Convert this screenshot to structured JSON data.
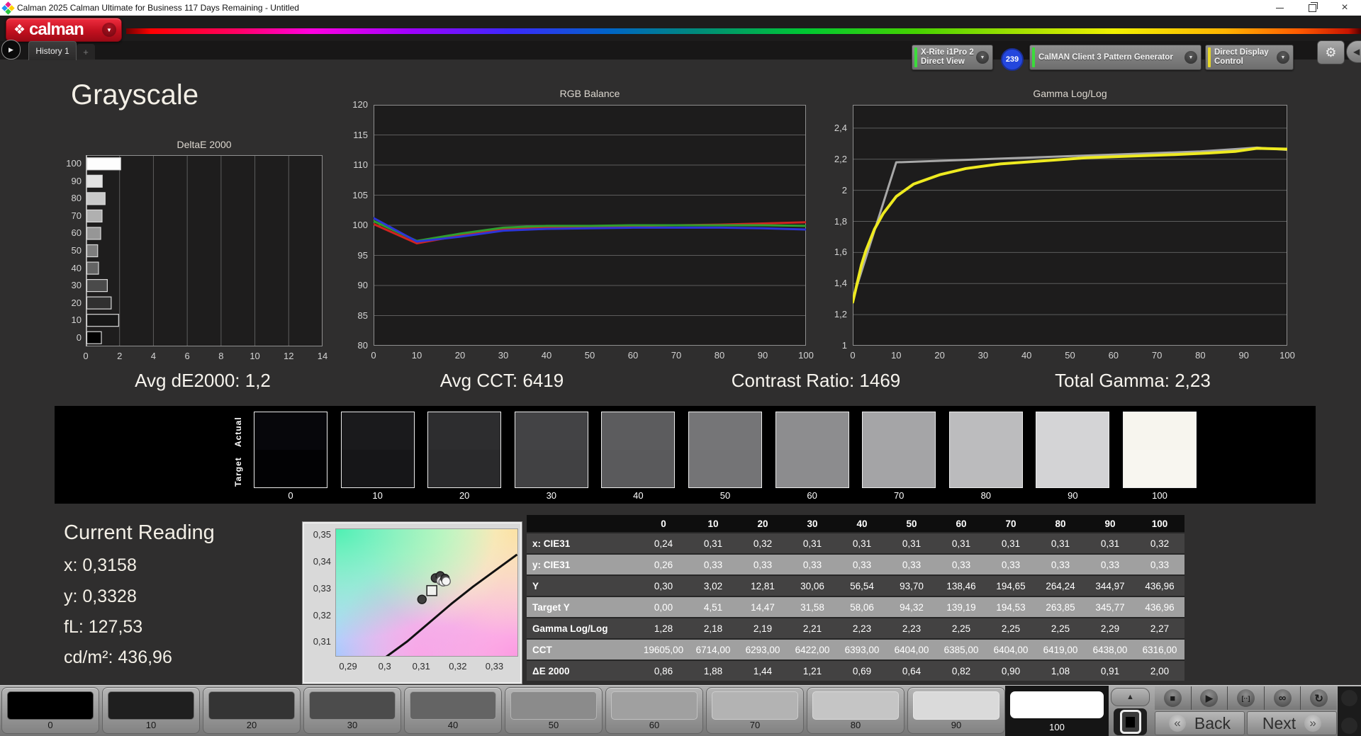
{
  "window": {
    "title": "Calman 2025 Calman Ultimate for Business 117 Days Remaining  - Untitled"
  },
  "icons": {
    "logo_diamond": "❖",
    "dropdown_arrow": "▼",
    "history_play": "▶",
    "gear": "⚙",
    "collapse": "◀",
    "scroll_up": "▲",
    "close": "×"
  },
  "header": {
    "logo_text": "calman",
    "badge": "239",
    "devices": [
      {
        "name": "meter-dropdown",
        "line1": "X-Rite i1Pro 2",
        "line2": "Direct View",
        "accent": "#3bdc3b"
      },
      {
        "name": "pattern-generator-dropdown",
        "line1": "CalMAN Client 3 Pattern Generator",
        "line2": "",
        "accent": "#3bdc3b"
      },
      {
        "name": "display-control-dropdown",
        "line1": "Direct Display Control",
        "line2": "",
        "accent": "#e6d62a"
      }
    ]
  },
  "tabs": {
    "history": "History 1",
    "add": "+"
  },
  "page": {
    "title": "Grayscale"
  },
  "stats": [
    {
      "text": "Avg dE2000: 1,2"
    },
    {
      "text": "Avg CCT: 6419"
    },
    {
      "text": "Contrast Ratio: 1469"
    },
    {
      "text": "Total Gamma: 2,23"
    }
  ],
  "chart_data": {
    "deltae": {
      "type": "bar",
      "title": "DeltaE 2000",
      "orientation": "horizontal",
      "categories": [
        "100",
        "90",
        "80",
        "70",
        "60",
        "50",
        "40",
        "30",
        "20",
        "10",
        "0"
      ],
      "values": [
        2.0,
        0.91,
        1.08,
        0.9,
        0.82,
        0.64,
        0.69,
        1.21,
        1.44,
        1.88,
        0.86
      ],
      "xlim": [
        0,
        14
      ],
      "xticks": [
        0,
        2,
        4,
        6,
        8,
        10,
        12,
        14
      ],
      "bar_colors": [
        "#fdfdfd",
        "#e2e2e2",
        "#c9c9c9",
        "#b0b0b0",
        "#969696",
        "#7d7d7d",
        "#636363",
        "#4a4a4a",
        "#303030",
        "#171717",
        "#020202"
      ]
    },
    "rgb_balance": {
      "type": "line",
      "title": "RGB Balance",
      "x": [
        0,
        10,
        20,
        30,
        40,
        50,
        60,
        70,
        80,
        90,
        100
      ],
      "xticks": [
        0,
        10,
        20,
        30,
        40,
        50,
        60,
        70,
        80,
        90,
        100
      ],
      "ylim": [
        80,
        120
      ],
      "yticks": [
        {
          "v": 120,
          "label": "120"
        },
        {
          "v": 115,
          "label": "115"
        },
        {
          "v": 110,
          "label": "110"
        },
        {
          "v": 105,
          "label": "105"
        },
        {
          "v": 100,
          "label": "100"
        },
        {
          "v": 95,
          "label": "95"
        },
        {
          "v": 90,
          "label": "90"
        },
        {
          "v": 85,
          "label": "85"
        },
        {
          "v": 80,
          "label": "80"
        }
      ],
      "series": [
        {
          "name": "Red",
          "color": "#d02420",
          "width": 3,
          "values": [
            100.2,
            97.0,
            98.3,
            99.3,
            99.7,
            99.7,
            99.9,
            100.0,
            100.1,
            100.3,
            100.5
          ]
        },
        {
          "name": "Green",
          "color": "#2f9e2f",
          "width": 3,
          "values": [
            100.7,
            97.4,
            98.6,
            99.6,
            99.9,
            99.9,
            100.0,
            100.0,
            100.0,
            100.0,
            99.9
          ]
        },
        {
          "name": "Blue",
          "color": "#2c35d8",
          "width": 3,
          "values": [
            101.2,
            97.3,
            98.1,
            99.1,
            99.4,
            99.5,
            99.6,
            99.6,
            99.6,
            99.5,
            99.3
          ]
        }
      ]
    },
    "gamma": {
      "type": "line",
      "title": "Gamma Log/Log",
      "xlim": [
        0,
        100
      ],
      "xticks": [
        0,
        10,
        20,
        30,
        40,
        50,
        60,
        70,
        80,
        90,
        100
      ],
      "ylim": [
        1,
        2.55
      ],
      "yticks": [
        {
          "v": 2.4,
          "label": "2,4"
        },
        {
          "v": 2.2,
          "label": "2,2"
        },
        {
          "v": 2.0,
          "label": "2"
        },
        {
          "v": 1.8,
          "label": "1,8"
        },
        {
          "v": 1.6,
          "label": "1,6"
        },
        {
          "v": 1.4,
          "label": "1,4"
        },
        {
          "v": 1.2,
          "label": "1,2"
        },
        {
          "v": 1.0,
          "label": "1"
        }
      ],
      "series": [
        {
          "name": "Target",
          "color": "#a8a8a8",
          "width": 3,
          "x": [
            0,
            10,
            20,
            30,
            40,
            50,
            60,
            70,
            80,
            88,
            93,
            100
          ],
          "values": [
            1.3,
            2.18,
            2.19,
            2.2,
            2.21,
            2.22,
            2.23,
            2.24,
            2.25,
            2.265,
            2.275,
            2.26
          ]
        },
        {
          "name": "Measured",
          "color": "#eeea20",
          "width": 4,
          "x": [
            0,
            1,
            2,
            3,
            5,
            7,
            10,
            14,
            20,
            26,
            34,
            44,
            54,
            64,
            74,
            82,
            88,
            93,
            100
          ],
          "values": [
            1.28,
            1.4,
            1.52,
            1.61,
            1.75,
            1.85,
            1.96,
            2.04,
            2.1,
            2.14,
            2.17,
            2.19,
            2.21,
            2.22,
            2.23,
            2.24,
            2.25,
            2.27,
            2.265
          ]
        }
      ]
    },
    "cie": {
      "type": "scatter",
      "xlim": [
        0.2865,
        0.3365
      ],
      "ylim": [
        0.3045,
        0.3525
      ],
      "xticks": [
        {
          "v": 0.29,
          "label": "0,29"
        },
        {
          "v": 0.3,
          "label": "0,3"
        },
        {
          "v": 0.31,
          "label": "0,31"
        },
        {
          "v": 0.32,
          "label": "0,32"
        },
        {
          "v": 0.33,
          "label": "0,33"
        }
      ],
      "yticks": [
        {
          "v": 0.35,
          "label": "0,35"
        },
        {
          "v": 0.34,
          "label": "0,34"
        },
        {
          "v": 0.33,
          "label": "0,33"
        },
        {
          "v": 0.32,
          "label": "0,32"
        },
        {
          "v": 0.31,
          "label": "0,31"
        }
      ],
      "locus": [
        [
          0.3,
          0.3045
        ],
        [
          0.306,
          0.3105
        ],
        [
          0.312,
          0.3175
        ],
        [
          0.318,
          0.3245
        ],
        [
          0.324,
          0.331
        ],
        [
          0.33,
          0.337
        ],
        [
          0.336,
          0.343
        ]
      ],
      "points": [
        {
          "x": 0.3137,
          "y": 0.3342,
          "fill": "dark"
        },
        {
          "x": 0.315,
          "y": 0.335,
          "fill": "dark"
        },
        {
          "x": 0.3152,
          "y": 0.3332,
          "fill": "light"
        },
        {
          "x": 0.3158,
          "y": 0.3328,
          "fill": "light"
        },
        {
          "x": 0.3163,
          "y": 0.334,
          "fill": "dark"
        },
        {
          "x": 0.3166,
          "y": 0.333,
          "fill": "light"
        },
        {
          "x": 0.31,
          "y": 0.3262,
          "fill": "dark"
        }
      ],
      "target": {
        "x": 0.3127,
        "y": 0.3295
      }
    }
  },
  "swatches": {
    "actual_label": "Actual",
    "target_label": "Target",
    "levels": [
      "0",
      "10",
      "20",
      "30",
      "40",
      "50",
      "60",
      "70",
      "80",
      "90",
      "100"
    ],
    "actual": [
      "#07070b",
      "#1a1a1c",
      "#2d2d2f",
      "#434345",
      "#5c5c5e",
      "#757577",
      "#8d8d8f",
      "#a5a5a7",
      "#bcbcbe",
      "#d4d4d6",
      "#f7f5ee"
    ],
    "target": [
      "#020204",
      "#161618",
      "#2a2a2c",
      "#414143",
      "#5a5a5c",
      "#747476",
      "#8c8c8e",
      "#a4a4a6",
      "#bbbbbd",
      "#d3d3d5",
      "#f8f6f0"
    ]
  },
  "reading": {
    "title": "Current Reading",
    "lines": [
      "x: 0,3158",
      "y: 0,3328",
      "fL: 127,53",
      "cd/m²: 436,96"
    ]
  },
  "table": {
    "columns": [
      "",
      "0",
      "10",
      "20",
      "30",
      "40",
      "50",
      "60",
      "70",
      "80",
      "90",
      "100"
    ],
    "rows": [
      {
        "label": "x: CIE31",
        "shade": "dark",
        "values": [
          "0,24",
          "0,31",
          "0,32",
          "0,31",
          "0,31",
          "0,31",
          "0,31",
          "0,31",
          "0,31",
          "0,31",
          "0,32"
        ]
      },
      {
        "label": "y: CIE31",
        "shade": "light",
        "values": [
          "0,26",
          "0,33",
          "0,33",
          "0,33",
          "0,33",
          "0,33",
          "0,33",
          "0,33",
          "0,33",
          "0,33",
          "0,33"
        ]
      },
      {
        "label": "Y",
        "shade": "dark",
        "values": [
          "0,30",
          "3,02",
          "12,81",
          "30,06",
          "56,54",
          "93,70",
          "138,46",
          "194,65",
          "264,24",
          "344,97",
          "436,96"
        ]
      },
      {
        "label": "Target Y",
        "shade": "light",
        "values": [
          "0,00",
          "4,51",
          "14,47",
          "31,58",
          "58,06",
          "94,32",
          "139,19",
          "194,53",
          "263,85",
          "345,77",
          "436,96"
        ]
      },
      {
        "label": "Gamma Log/Log",
        "shade": "dark",
        "values": [
          "1,28",
          "2,18",
          "2,19",
          "2,21",
          "2,23",
          "2,23",
          "2,25",
          "2,25",
          "2,25",
          "2,29",
          "2,27"
        ]
      },
      {
        "label": "CCT",
        "shade": "light",
        "values": [
          "19605,00",
          "6714,00",
          "6293,00",
          "6422,00",
          "6393,00",
          "6404,00",
          "6385,00",
          "6404,00",
          "6419,00",
          "6438,00",
          "6316,00"
        ]
      },
      {
        "label": "ΔE 2000",
        "shade": "dark",
        "values": [
          "0,86",
          "1,88",
          "1,44",
          "1,21",
          "0,69",
          "0,64",
          "0,82",
          "0,90",
          "1,08",
          "0,91",
          "2,00"
        ]
      }
    ]
  },
  "bottom": {
    "patches": [
      {
        "label": "0",
        "color": "#000000"
      },
      {
        "label": "10",
        "color": "#1f1f1f"
      },
      {
        "label": "20",
        "color": "#343434"
      },
      {
        "label": "30",
        "color": "#4c4c4c"
      },
      {
        "label": "40",
        "color": "#646464"
      },
      {
        "label": "50",
        "color": "#8b8b8b"
      },
      {
        "label": "60",
        "color": "#a0a0a0"
      },
      {
        "label": "70",
        "color": "#b3b3b3"
      },
      {
        "label": "80",
        "color": "#c5c5c5"
      },
      {
        "label": "90",
        "color": "#dadada"
      },
      {
        "label": "100",
        "color": "#ffffff"
      }
    ],
    "selected": "100",
    "controls": [
      {
        "name": "stop",
        "glyph": "■"
      },
      {
        "name": "play",
        "glyph": "▶"
      },
      {
        "name": "interval",
        "glyph": "[··]"
      },
      {
        "name": "loop",
        "glyph": "∞"
      },
      {
        "name": "refresh",
        "glyph": "↻"
      }
    ],
    "back_icon": "«",
    "back_label": "Back",
    "next_icon": "»",
    "next_label": "Next"
  }
}
